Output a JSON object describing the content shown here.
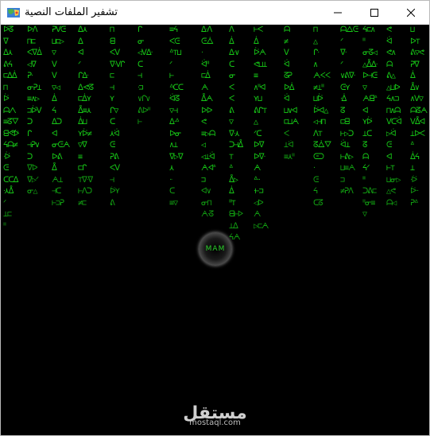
{
  "window": {
    "title": "تشفير الملفات النصية",
    "icon": "map-icon",
    "controls": [
      "minimize-icon",
      "maximize-icon",
      "close-icon"
    ]
  },
  "rain": {
    "color": "#17c917",
    "glyphs": "ᗅᐯᐱᐃᐅᘔᓂᕮᗩᗺᐦᐧᕈᔦᐊᐸᑕᑐᒋᕕᕙᐁᐂᐄᐍᐏᐖᐛᐟᐞ⊐⊏⊓⊔⊢⊣⊥⊤△▽◁▷⋏⋎∧∨≡≠"
  },
  "center": {
    "label": "MAM"
  },
  "watermark": {
    "logo": "مستقل",
    "url": "mostaql.com"
  }
}
